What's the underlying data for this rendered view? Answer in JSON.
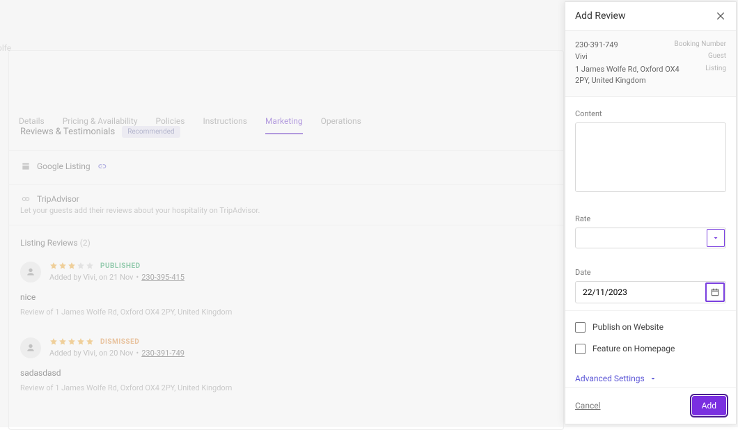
{
  "page": {
    "name_stub": "olfe",
    "tabs": [
      "Details",
      "Pricing & Availability",
      "Policies",
      "Instructions",
      "Marketing",
      "Operations"
    ],
    "active_tab_index": 4
  },
  "reviews_section": {
    "title": "Reviews & Testimonials",
    "badge": "Recommended",
    "google_listing": "Google Listing",
    "tripadvisor": "TripAdvisor",
    "tripadvisor_sub": "Let your guests add their reviews about your hospitality on TripAdvisor.",
    "listing_reviews_label": "Listing Reviews",
    "listing_reviews_count": "(2)"
  },
  "reviews": [
    {
      "stars": 3,
      "status": "PUBLISHED",
      "status_class": "status-pub",
      "added_by": "Added by Vivi, on 21 Nov",
      "booking_ref": "230-395-415",
      "body": "nice",
      "review_of": "Review of 1 James Wolfe Rd, Oxford OX4 2PY, United Kingdom"
    },
    {
      "stars": 5,
      "status": "DISMISSED",
      "status_class": "status-dis",
      "added_by": "Added by Vivi, on 20 Nov",
      "booking_ref": "230-391-749",
      "body": "sadasdasd",
      "review_of": "Review of 1 James Wolfe Rd, Oxford OX4 2PY, United Kingdom"
    }
  ],
  "panel": {
    "title": "Add Review",
    "booking_number": "230-391-749",
    "booking_number_label": "Booking Number",
    "guest_name": "Vivi",
    "guest_label": "Guest",
    "listing_address": "1 James Wolfe Rd, Oxford OX4 2PY, United Kingdom",
    "listing_label": "Listing",
    "content_label": "Content",
    "content_value": "",
    "rate_label": "Rate",
    "rate_value": "",
    "date_label": "Date",
    "date_value": "22/11/2023",
    "publish_website": "Publish on Website",
    "feature_homepage": "Feature on Homepage",
    "advanced": "Advanced Settings",
    "cancel": "Cancel",
    "add": "Add"
  }
}
